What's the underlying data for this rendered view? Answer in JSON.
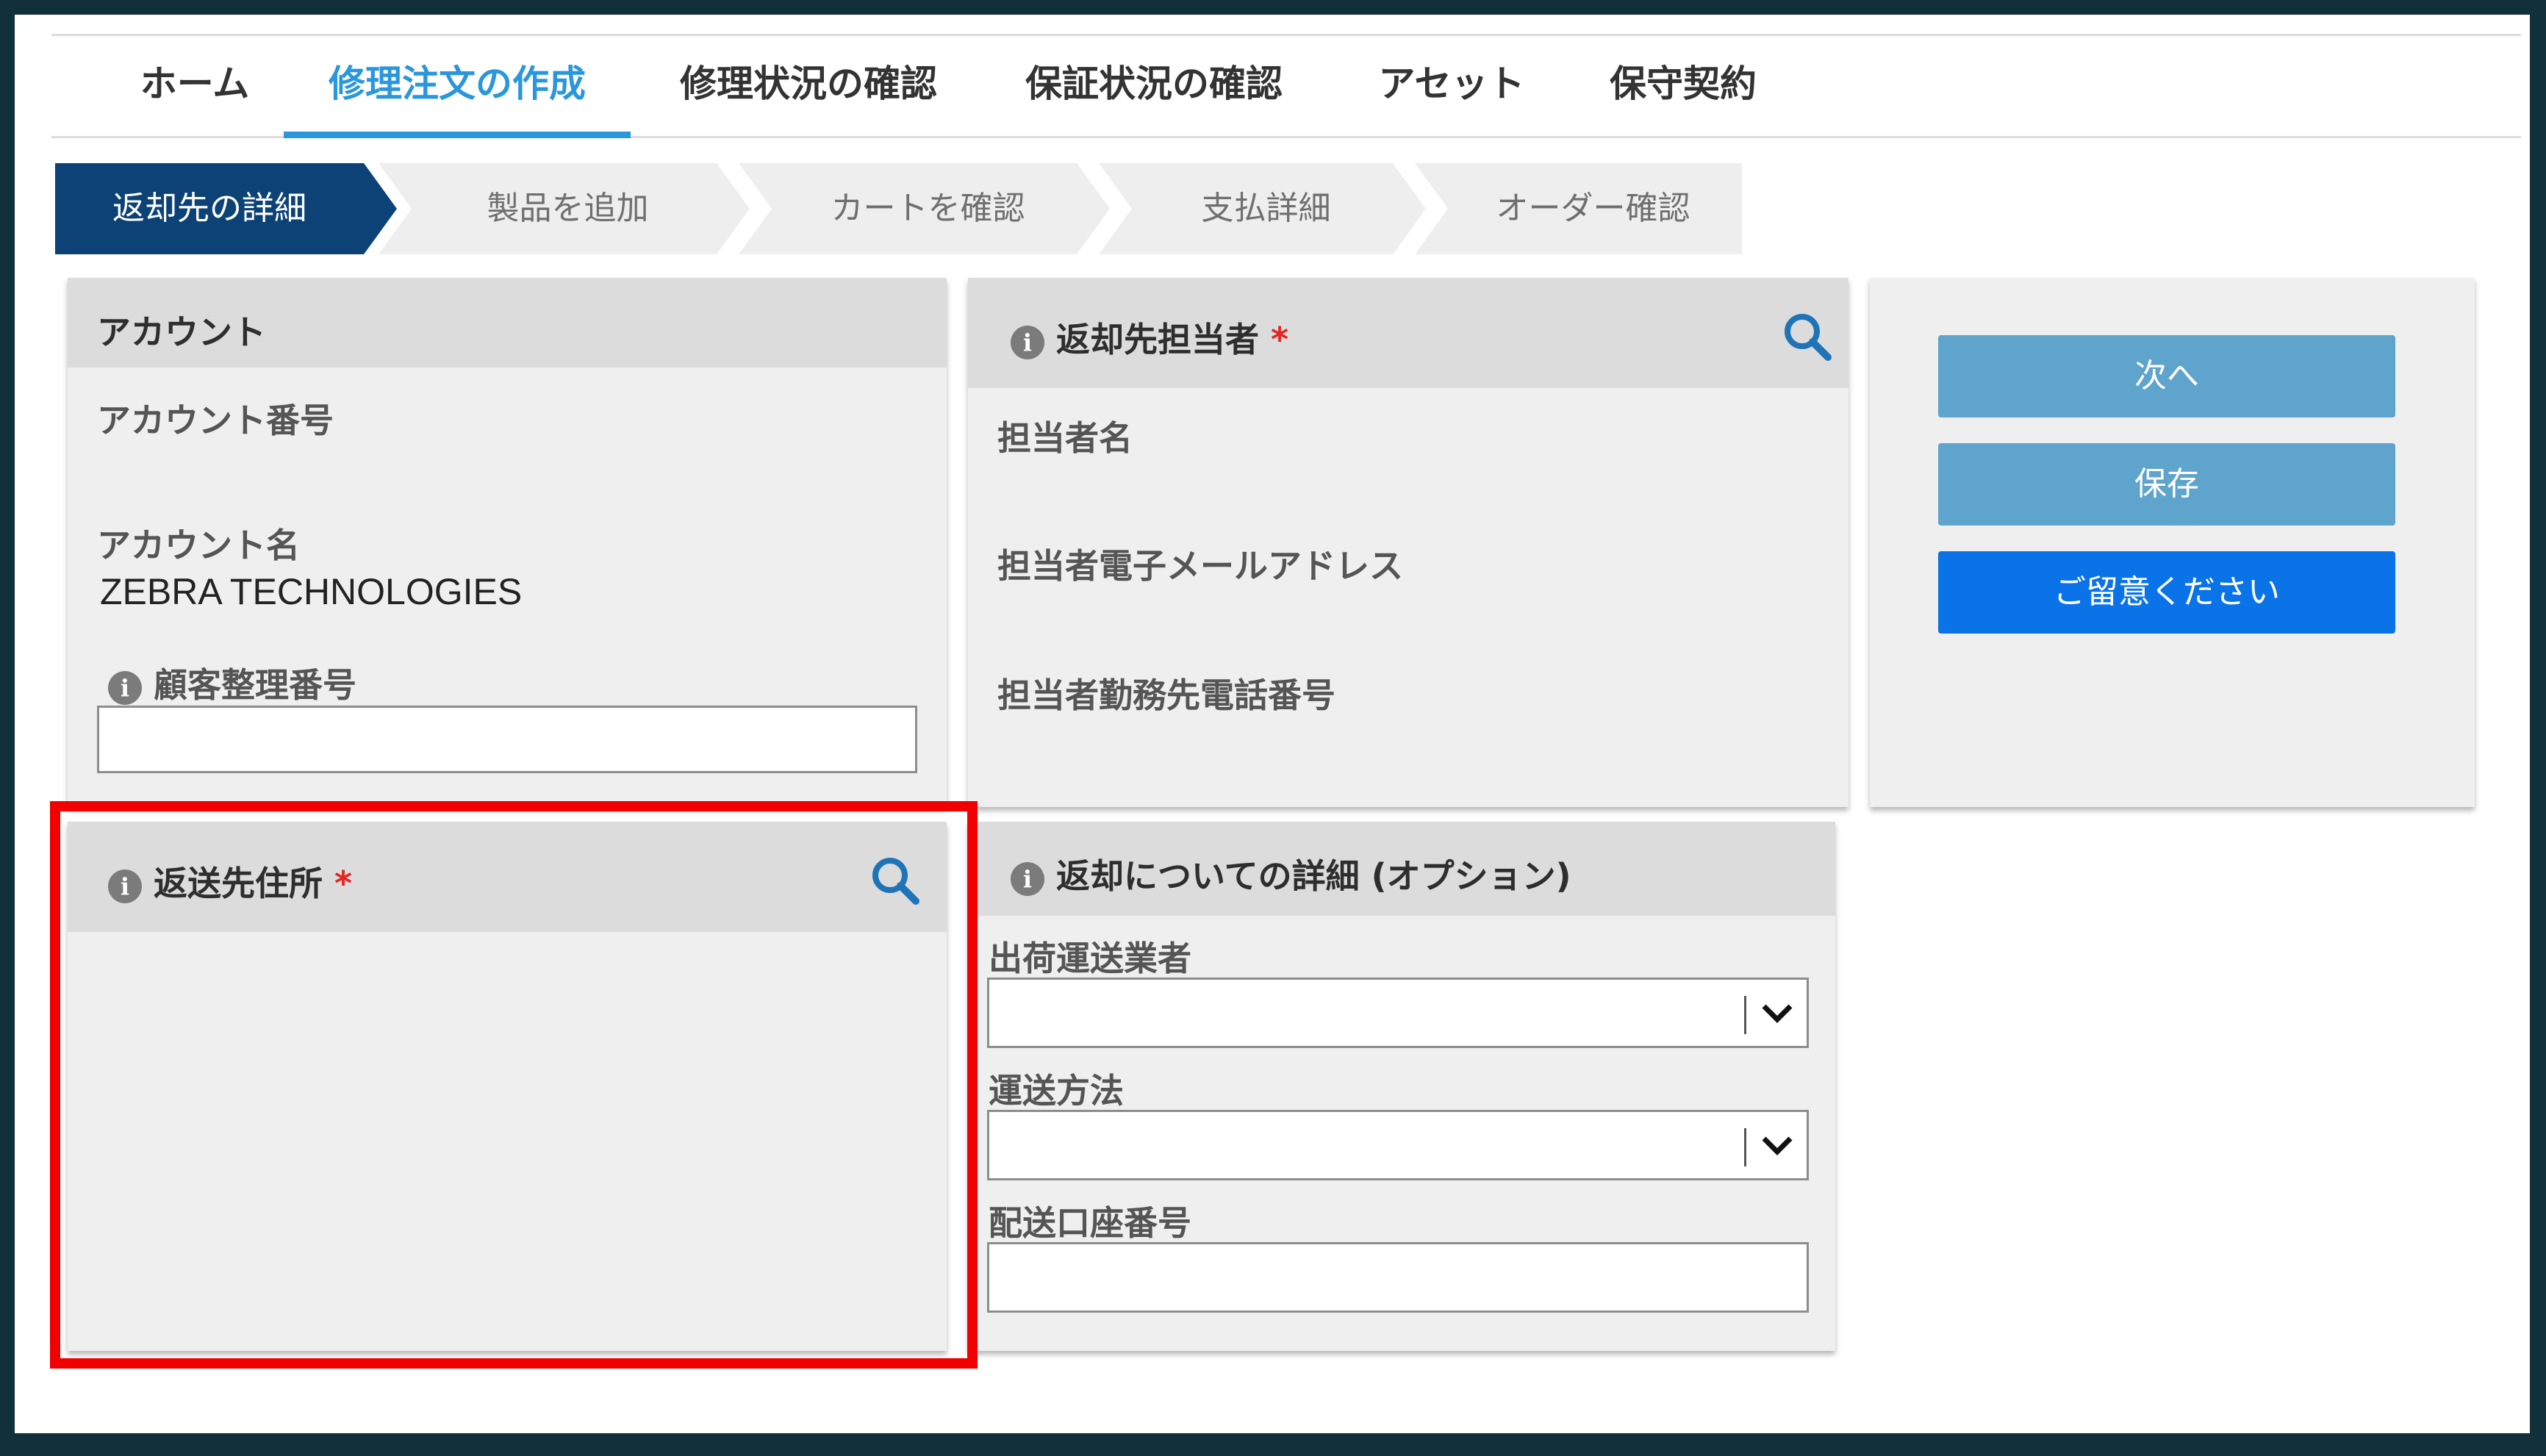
{
  "nav": {
    "tabs": [
      {
        "label": "ホーム"
      },
      {
        "label": "修理注文の作成"
      },
      {
        "label": "修理状況の確認"
      },
      {
        "label": "保証状況の確認"
      },
      {
        "label": "アセット"
      },
      {
        "label": "保守契約"
      }
    ],
    "active_index": 1
  },
  "steps": [
    {
      "label": "返却先の詳細"
    },
    {
      "label": "製品を追加"
    },
    {
      "label": "カートを確認"
    },
    {
      "label": "支払詳細"
    },
    {
      "label": "オーダー確認"
    }
  ],
  "account": {
    "header": "アカウント",
    "number_label": "アカウント番号",
    "number_value": "",
    "name_label": "アカウント名",
    "name_value": "ZEBRA TECHNOLOGIES",
    "ref_label": "顧客整理番号",
    "ref_value": ""
  },
  "contact": {
    "header": "返却先担当者",
    "required_mark": "*",
    "name_label": "担当者名",
    "email_label": "担当者電子メールアドレス",
    "phone_label": "担当者勤務先電話番号"
  },
  "actions": {
    "next": "次へ",
    "save": "保存",
    "notice": "ご留意ください"
  },
  "return_address": {
    "header": "返送先住所",
    "required_mark": "*"
  },
  "return_details": {
    "header": "返却についての詳細 (オプション)",
    "carrier_label": "出荷運送業者",
    "carrier_value": "",
    "method_label": "運送方法",
    "method_value": "",
    "account_label": "配送口座番号",
    "account_value": ""
  },
  "icons": {
    "info": "info-icon",
    "search": "search-icon",
    "dropdown": "chevron-down-icon"
  },
  "colors": {
    "accent": "#2a96db",
    "step_active": "#0c4276",
    "primary_button": "#0a73e8",
    "muted_button": "#5ea4cd",
    "required": "#e52424",
    "highlight": "#f20000"
  }
}
